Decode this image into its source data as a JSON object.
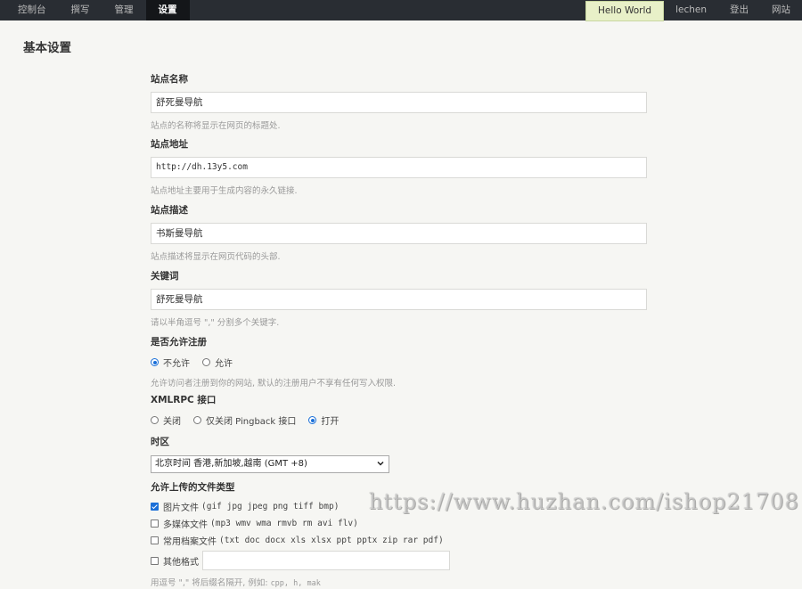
{
  "nav": {
    "left": [
      "控制台",
      "撰写",
      "管理",
      "设置"
    ],
    "active": "设置",
    "hello": "Hello World",
    "user": "lechen",
    "logout": "登出",
    "site": "网站"
  },
  "page_title": "基本设置",
  "fields": {
    "site_name": {
      "label": "站点名称",
      "value": "舒死曼导航",
      "desc": "站点的名称将显示在网页的标题处."
    },
    "site_url": {
      "label": "站点地址",
      "value": "http://dh.13y5.com",
      "desc": "站点地址主要用于生成内容的永久链接."
    },
    "site_desc": {
      "label": "站点描述",
      "value": "书斯曼导航",
      "desc": "站点描述将显示在网页代码的头部."
    },
    "keywords": {
      "label": "关键词",
      "value": "舒死曼导航",
      "desc": "请以半角逗号 \",\" 分割多个关键字."
    },
    "register": {
      "label": "是否允许注册",
      "options": [
        "不允许",
        "允许"
      ],
      "selected": "不允许",
      "desc": "允许访问者注册到你的网站, 默认的注册用户不享有任何写入权限."
    },
    "xmlrpc": {
      "label": "XMLRPC 接口",
      "options": [
        "关闭",
        "仅关闭 Pingback 接口",
        "打开"
      ],
      "selected": "打开"
    },
    "timezone": {
      "label": "时区",
      "selected": "北京时间 香港,新加坡,越南 (GMT +8)"
    },
    "uploads": {
      "label": "允许上传的文件类型",
      "items": [
        {
          "name": "图片文件",
          "exts": "(gif jpg jpeg png tiff bmp)",
          "checked": true
        },
        {
          "name": "多媒体文件",
          "exts": "(mp3 wmv wma rmvb rm avi flv)",
          "checked": false
        },
        {
          "name": "常用档案文件",
          "exts": "(txt doc docx xls xlsx ppt pptx zip rar pdf)",
          "checked": false
        }
      ],
      "other_label": "其他格式",
      "other_value": "",
      "desc_prefix": "用逗号 \",\" 将后缀名隔开, 例如: ",
      "desc_example": "cpp, h, mak"
    }
  },
  "watermark": "https://www.huzhan.com/ishop21708",
  "colors": {
    "topbar": "#292d33",
    "accent": "#1a6fd8",
    "page_bg": "#f6f6f3"
  }
}
